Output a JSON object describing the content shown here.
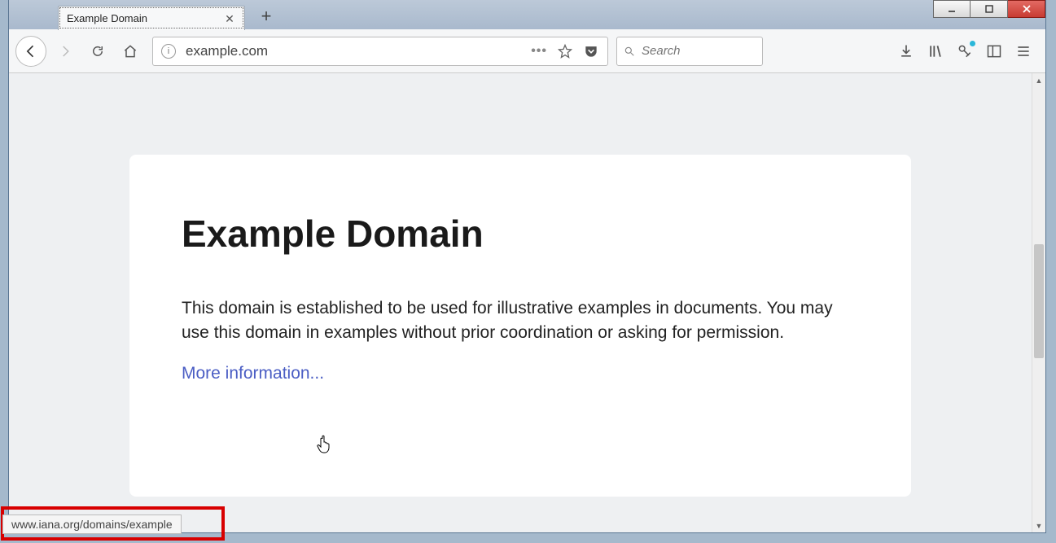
{
  "tab": {
    "title": "Example Domain"
  },
  "urlbar": {
    "value": "example.com"
  },
  "searchbar": {
    "placeholder": "Search"
  },
  "page": {
    "heading": "Example Domain",
    "paragraph": "This domain is established to be used for illustrative examples in documents. You may use this domain in examples without prior coordination or asking for permission.",
    "link_text": "More information..."
  },
  "status": {
    "hover_url": "www.iana.org/domains/example"
  }
}
